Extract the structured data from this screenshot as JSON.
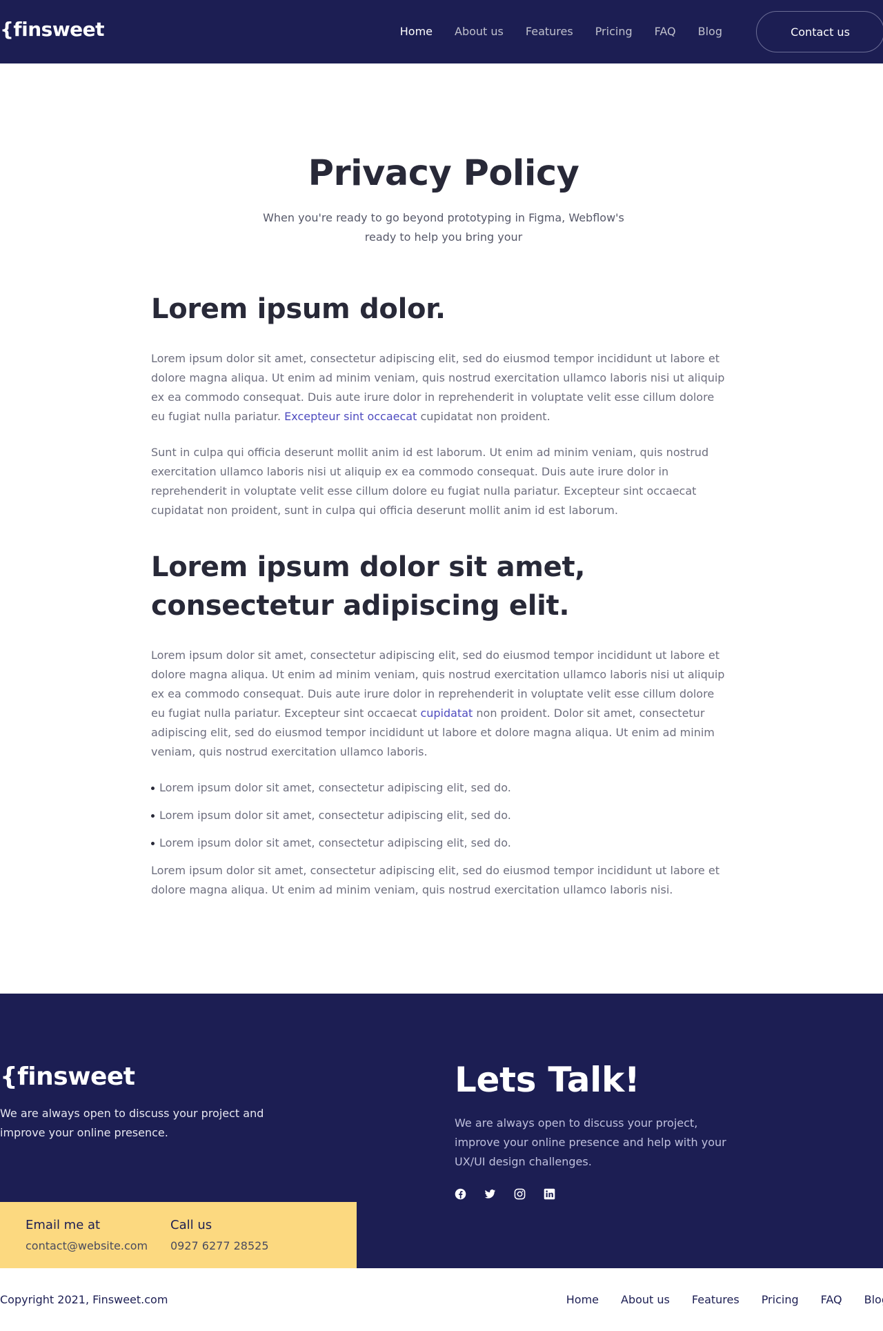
{
  "header": {
    "logo": "{finsweet",
    "nav": [
      {
        "label": "Home",
        "active": true
      },
      {
        "label": "About us",
        "active": false
      },
      {
        "label": "Features",
        "active": false
      },
      {
        "label": "Pricing",
        "active": false
      },
      {
        "label": "FAQ",
        "active": false
      },
      {
        "label": "Blog",
        "active": false
      }
    ],
    "cta_label": "Contact us"
  },
  "hero": {
    "title": "Privacy Policy",
    "subtitle": "When you're ready to go beyond prototyping in Figma, Webflow's ready to help you bring your"
  },
  "content": {
    "section1": {
      "heading": "Lorem ipsum dolor.",
      "p1_before": "Lorem ipsum dolor sit amet, consectetur adipiscing elit, sed do eiusmod tempor incididunt ut labore et dolore magna aliqua. Ut enim ad minim veniam, quis nostrud exercitation ullamco laboris nisi ut aliquip ex ea commodo consequat. Duis aute irure dolor in reprehenderit in voluptate velit esse cillum dolore eu fugiat nulla pariatur. ",
      "p1_link": "Excepteur sint occaecat",
      "p1_after": " cupidatat non proident.",
      "p2": "Sunt in culpa qui officia deserunt mollit anim id est laborum. Ut enim ad minim veniam, quis nostrud exercitation ullamco laboris nisi ut aliquip ex ea commodo consequat. Duis aute irure dolor in reprehenderit in voluptate velit esse cillum dolore eu fugiat nulla pariatur. Excepteur sint occaecat cupidatat non proident, sunt in culpa qui officia deserunt mollit anim id est laborum."
    },
    "section2": {
      "heading": "Lorem ipsum dolor sit amet, consectetur adipiscing elit.",
      "p1_before": "Lorem ipsum dolor sit amet, consectetur adipiscing elit, sed do eiusmod tempor incididunt ut labore et dolore magna aliqua. Ut enim ad minim veniam, quis nostrud exercitation ullamco laboris nisi ut aliquip ex ea commodo consequat. Duis aute irure dolor in reprehenderit in voluptate velit esse cillum dolore eu fugiat nulla pariatur. Excepteur sint occaecat ",
      "p1_link": "cupidatat",
      "p1_after": " non proident. Dolor sit amet, consectetur adipiscing elit, sed do eiusmod tempor incididunt ut labore et dolore magna aliqua. Ut enim ad minim veniam, quis nostrud exercitation ullamco laboris.",
      "bullets": [
        "Lorem ipsum dolor sit amet, consectetur adipiscing elit, sed do.",
        "Lorem ipsum dolor sit amet, consectetur adipiscing elit, sed do.",
        "Lorem ipsum dolor sit amet, consectetur adipiscing elit, sed do."
      ],
      "p2": "Lorem ipsum dolor sit amet, consectetur adipiscing elit, sed do eiusmod tempor incididunt ut labore et dolore magna aliqua. Ut enim ad minim veniam, quis nostrud exercitation ullamco laboris nisi."
    }
  },
  "footer": {
    "logo": "{finsweet",
    "description": "We are always open to discuss your project and improve your online presence.",
    "email_title": "Email me at",
    "email": "contact@website.com",
    "phone_title": "Call us",
    "phone": "0927 6277 28525",
    "talk_title": "Lets Talk!",
    "talk_desc": "We are always open to discuss your project, improve your online presence and help with your UX/UI design challenges.",
    "social_icons": [
      "facebook-icon",
      "twitter-icon",
      "instagram-icon",
      "linkedin-icon"
    ]
  },
  "bottom": {
    "copyright": "Copyright 2021, Finsweet.com",
    "nav": [
      "Home",
      "About us",
      "Features",
      "Pricing",
      "FAQ",
      "Blog"
    ]
  },
  "colors": {
    "navy": "#1c1e53",
    "accent_yellow": "#fcd980",
    "link": "#4e4bbf",
    "heading": "#282938",
    "body_text": "#6d6e7e"
  }
}
